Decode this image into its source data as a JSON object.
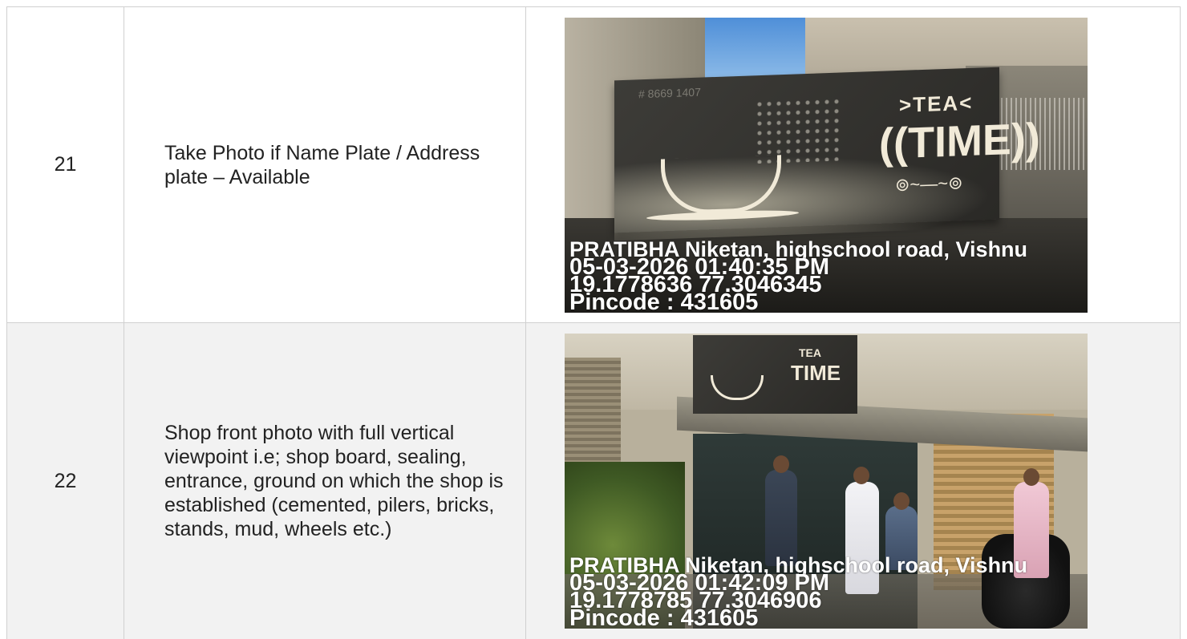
{
  "rows": [
    {
      "number": "21",
      "description": "Take Photo if Name Plate / Address plate – Available",
      "photo": {
        "board_phone": "# 8669 1407",
        "brand_top": ">TEA<",
        "brand_main": "((TIME))",
        "brand_flourish": "⊚~—~⊚",
        "address": "PRATIBHA Niketan, highschool road, Vishnu",
        "timestamp": "05-03-2026 01:40:35 PM",
        "coordinates": "19.1778636 77.3046345",
        "pincode": "Pincode : 431605"
      }
    },
    {
      "number": "22",
      "description": "Shop front photo with full vertical viewpoint i.e; shop board, sealing, entrance, ground on which the shop is established (cemented, pilers, bricks, stands, mud, wheels etc.)",
      "photo": {
        "brand_top": "TEA",
        "brand_main": "TIME",
        "address": "PRATIBHA Niketan, highschool road, Vishnu",
        "timestamp": "05-03-2026 01:42:09 PM",
        "coordinates": "19.1778785 77.3046906",
        "pincode": "Pincode : 431605"
      }
    }
  ]
}
